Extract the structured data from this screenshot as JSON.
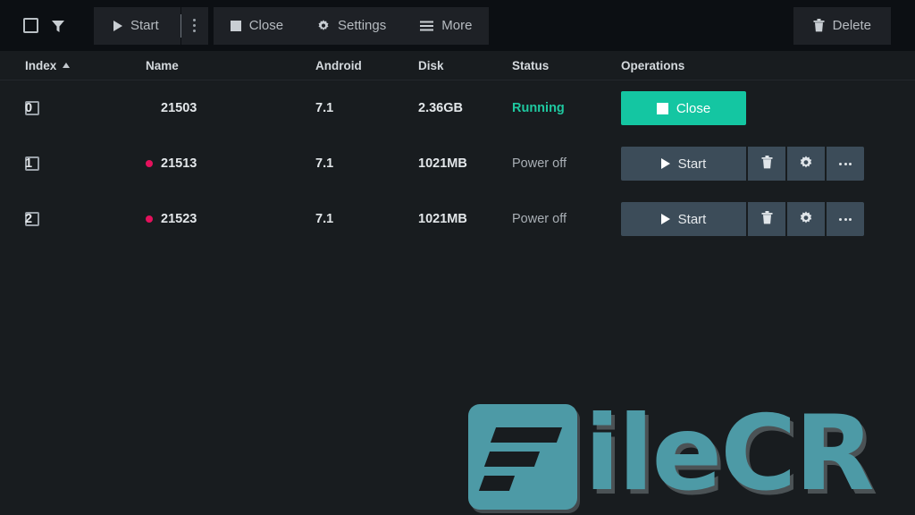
{
  "toolbar": {
    "select_all_name": "select-all-checkbox",
    "filter_label": "Filter",
    "buttons": [
      {
        "id": "start",
        "label": "Start",
        "icon": "play-icon"
      },
      {
        "id": "start-menu",
        "label": "",
        "icon": "kebab-menu-icon"
      },
      {
        "id": "close",
        "label": "Close",
        "icon": "stop-icon"
      },
      {
        "id": "settings",
        "label": "Settings",
        "icon": "gear-icon"
      },
      {
        "id": "more",
        "label": "More",
        "icon": "hamburger-icon"
      }
    ],
    "delete": {
      "label": "Delete",
      "icon": "trash-icon"
    }
  },
  "table": {
    "columns": [
      {
        "key": "index",
        "label": "Index",
        "sort": "asc"
      },
      {
        "key": "name",
        "label": "Name"
      },
      {
        "key": "android",
        "label": "Android"
      },
      {
        "key": "disk",
        "label": "Disk"
      },
      {
        "key": "status",
        "label": "Status"
      },
      {
        "key": "operations",
        "label": "Operations"
      }
    ],
    "rows": [
      {
        "index": "0",
        "name": "21503",
        "dot": false,
        "android": "7.1",
        "disk": "2.36GB",
        "status": "Running",
        "state": "running",
        "primary_action": "Close",
        "primary_icon": "stop-icon"
      },
      {
        "index": "1",
        "name": "21513",
        "dot": true,
        "android": "7.1",
        "disk": "1021MB",
        "status": "Power off",
        "state": "off",
        "primary_action": "Start",
        "primary_icon": "play-icon",
        "extra_actions": [
          "trash-icon",
          "gear-icon",
          "more-dots-icon"
        ]
      },
      {
        "index": "2",
        "name": "21523",
        "dot": true,
        "android": "7.1",
        "disk": "1021MB",
        "status": "Power off",
        "state": "off",
        "primary_action": "Start",
        "primary_icon": "play-icon",
        "extra_actions": [
          "trash-icon",
          "gear-icon",
          "more-dots-icon"
        ]
      }
    ]
  },
  "watermark": {
    "text": "ileCR",
    "brand": "FileCR"
  },
  "colors": {
    "toolbar_bg": "#0c0f13",
    "body_bg": "#181c1f",
    "button_bg": "#1e2126",
    "accent_teal": "#14c6a2",
    "op_button_bg": "#3c4c59",
    "status_dot": "#e4115c",
    "running_text": "#1fc8a0",
    "watermark_teal": "#4d9aa6"
  }
}
